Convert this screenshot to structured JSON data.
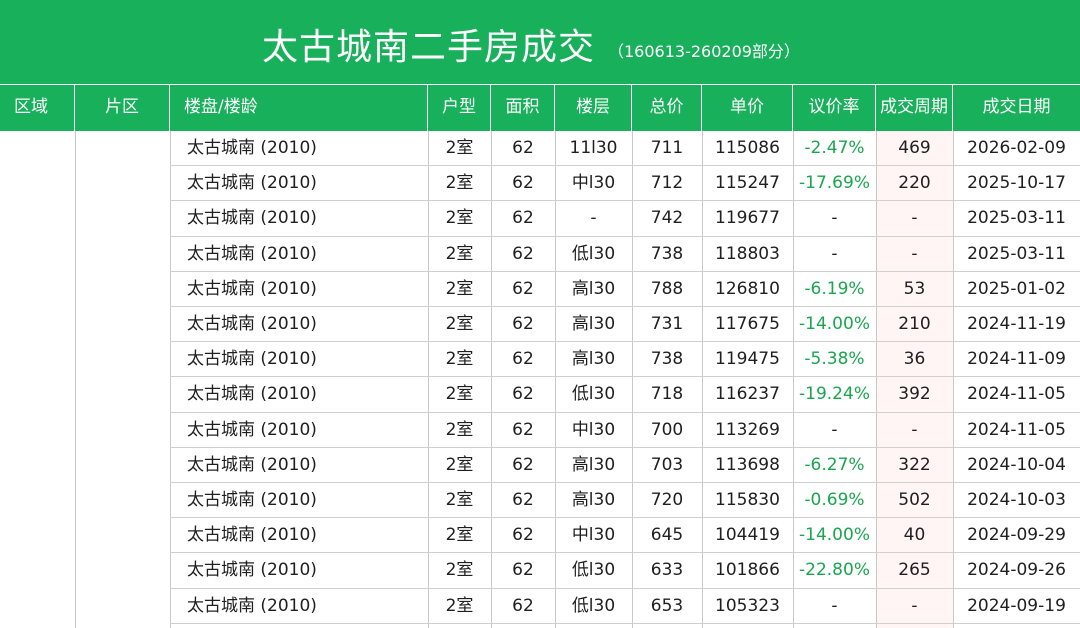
{
  "title": {
    "main": "太古城南二手房成交",
    "sub": "（160613-260209部分）"
  },
  "headers": [
    "区域",
    "片区",
    "楼盘/楼龄",
    "户型",
    "面积",
    "楼层",
    "总价",
    "单价",
    "议价率",
    "成交周期",
    "成交日期"
  ],
  "colors": {
    "header_green": "#18b05a",
    "rate_green": "#1aa64f",
    "grid": "#cfcfcf"
  },
  "rows": [
    {
      "estate": "太古城南 (2010)",
      "layout": "2室",
      "area": "62",
      "floor": "11l30",
      "total": "711",
      "unit": "115086",
      "rate": "-2.47%",
      "cycle": "469",
      "date": "2026-02-09"
    },
    {
      "estate": "太古城南 (2010)",
      "layout": "2室",
      "area": "62",
      "floor": "中l30",
      "total": "712",
      "unit": "115247",
      "rate": "-17.69%",
      "cycle": "220",
      "date": "2025-10-17"
    },
    {
      "estate": "太古城南 (2010)",
      "layout": "2室",
      "area": "62",
      "floor": "-",
      "total": "742",
      "unit": "119677",
      "rate": "-",
      "cycle": "-",
      "date": "2025-03-11"
    },
    {
      "estate": "太古城南 (2010)",
      "layout": "2室",
      "area": "62",
      "floor": "低l30",
      "total": "738",
      "unit": "118803",
      "rate": "-",
      "cycle": "-",
      "date": "2025-03-11"
    },
    {
      "estate": "太古城南 (2010)",
      "layout": "2室",
      "area": "62",
      "floor": "高l30",
      "total": "788",
      "unit": "126810",
      "rate": "-6.19%",
      "cycle": "53",
      "date": "2025-01-02"
    },
    {
      "estate": "太古城南 (2010)",
      "layout": "2室",
      "area": "62",
      "floor": "高l30",
      "total": "731",
      "unit": "117675",
      "rate": "-14.00%",
      "cycle": "210",
      "date": "2024-11-19"
    },
    {
      "estate": "太古城南 (2010)",
      "layout": "2室",
      "area": "62",
      "floor": "高l30",
      "total": "738",
      "unit": "119475",
      "rate": "-5.38%",
      "cycle": "36",
      "date": "2024-11-09"
    },
    {
      "estate": "太古城南 (2010)",
      "layout": "2室",
      "area": "62",
      "floor": "低l30",
      "total": "718",
      "unit": "116237",
      "rate": "-19.24%",
      "cycle": "392",
      "date": "2024-11-05"
    },
    {
      "estate": "太古城南 (2010)",
      "layout": "2室",
      "area": "62",
      "floor": "中l30",
      "total": "700",
      "unit": "113269",
      "rate": "-",
      "cycle": "-",
      "date": "2024-11-05"
    },
    {
      "estate": "太古城南 (2010)",
      "layout": "2室",
      "area": "62",
      "floor": "高l30",
      "total": "703",
      "unit": "113698",
      "rate": "-6.27%",
      "cycle": "322",
      "date": "2024-10-04"
    },
    {
      "estate": "太古城南 (2010)",
      "layout": "2室",
      "area": "62",
      "floor": "高l30",
      "total": "720",
      "unit": "115830",
      "rate": "-0.69%",
      "cycle": "502",
      "date": "2024-10-03"
    },
    {
      "estate": "太古城南 (2010)",
      "layout": "2室",
      "area": "62",
      "floor": "中l30",
      "total": "645",
      "unit": "104419",
      "rate": "-14.00%",
      "cycle": "40",
      "date": "2024-09-29"
    },
    {
      "estate": "太古城南 (2010)",
      "layout": "2室",
      "area": "62",
      "floor": "低l30",
      "total": "633",
      "unit": "101866",
      "rate": "-22.80%",
      "cycle": "265",
      "date": "2024-09-26"
    },
    {
      "estate": "太古城南 (2010)",
      "layout": "2室",
      "area": "62",
      "floor": "低l30",
      "total": "653",
      "unit": "105323",
      "rate": "-",
      "cycle": "-",
      "date": "2024-09-19"
    }
  ]
}
